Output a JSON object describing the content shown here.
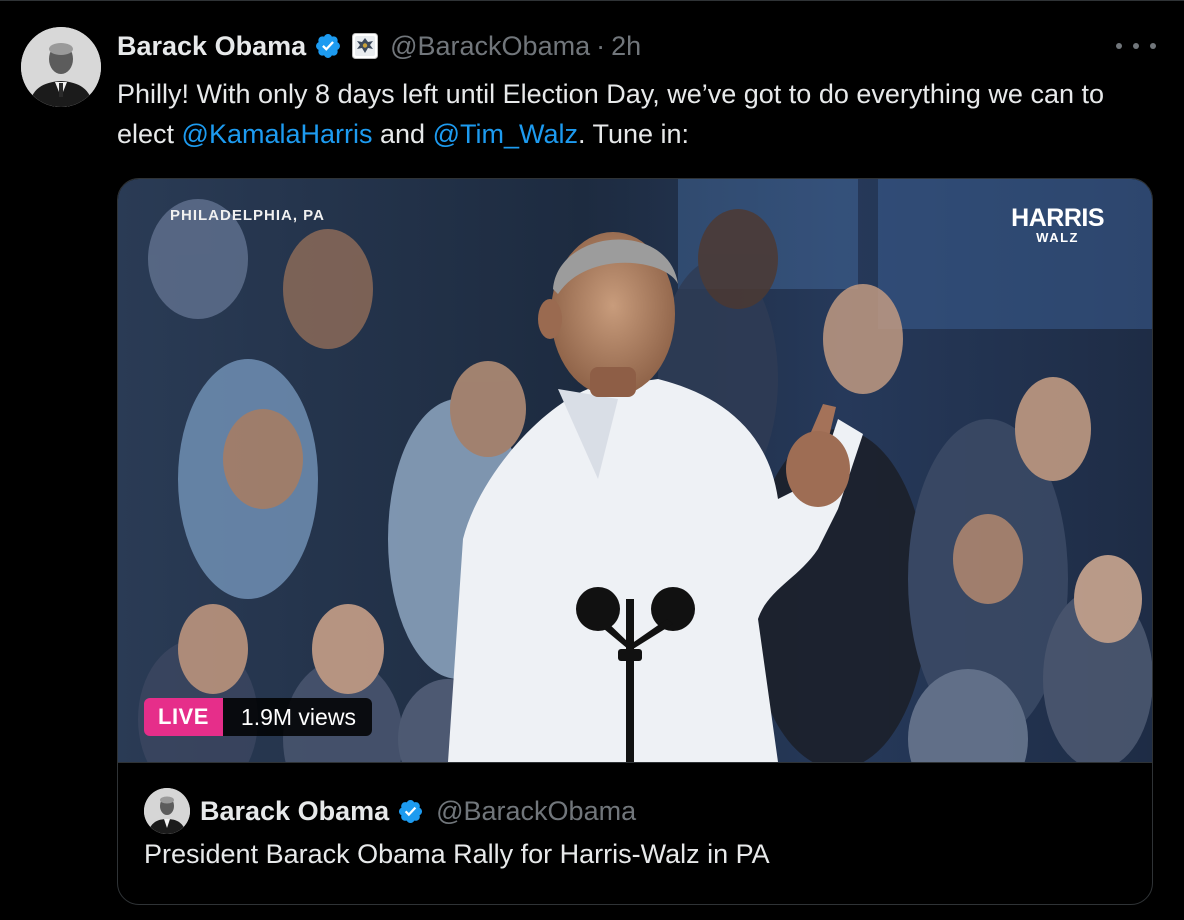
{
  "tweet": {
    "author_name": "Barack Obama",
    "handle": "@BarackObama",
    "separator": "·",
    "time": "2h",
    "text_1": "Philly! With only 8 days left until Election Day, we’ve got to do everything we can to elect ",
    "mention_1": "@KamalaHarris",
    "text_2": " and ",
    "mention_2": "@Tim_Walz",
    "text_3": ". Tune in:"
  },
  "video": {
    "location_caption": "PHILADELPHIA, PA",
    "logo_line1": "HARRIS",
    "logo_line2": "WALZ",
    "live_label": "LIVE",
    "views": "1.9M views"
  },
  "quoted": {
    "author_name": "Barack Obama",
    "handle": "@BarackObama",
    "title": "President Barack Obama Rally for Harris-Walz in PA"
  },
  "colors": {
    "background": "#000000",
    "text": "#e7e9ea",
    "muted": "#71767b",
    "link": "#1d9bf0",
    "live_badge": "#e62e8a",
    "border": "#2f3336"
  },
  "icons": {
    "verified": "verified-badge-icon",
    "affiliate": "government-seal-icon",
    "more": "more-dots-icon"
  }
}
